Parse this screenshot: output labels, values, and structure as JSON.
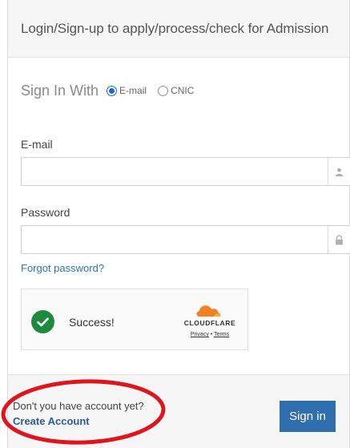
{
  "header": {
    "title": "Login/Sign-up to apply/process/check for Admission"
  },
  "signin_with": {
    "label": "Sign In With",
    "options": [
      {
        "label": "E-mail",
        "selected": true
      },
      {
        "label": "CNIC",
        "selected": false
      }
    ]
  },
  "form": {
    "email": {
      "label": "E-mail",
      "value": "",
      "placeholder": "",
      "icon": "user-icon"
    },
    "password": {
      "label": "Password",
      "value": "",
      "placeholder": "",
      "icon": "lock-icon"
    },
    "forgot_password": "Forgot password?"
  },
  "captcha": {
    "status": "Success!",
    "brand": "CLOUDFLARE",
    "privacy": "Privacy",
    "separator": "•",
    "terms": "Terms",
    "status_color": "#1d8a3e",
    "brand_color": "#f38020"
  },
  "footer": {
    "no_account_text": "Don't you have account yet?",
    "create_account": "Create Account",
    "sign_in_button": "Sign in"
  },
  "colors": {
    "primary": "#2f6fb0",
    "link": "#2f73b7",
    "annotation": "#e0141d"
  }
}
